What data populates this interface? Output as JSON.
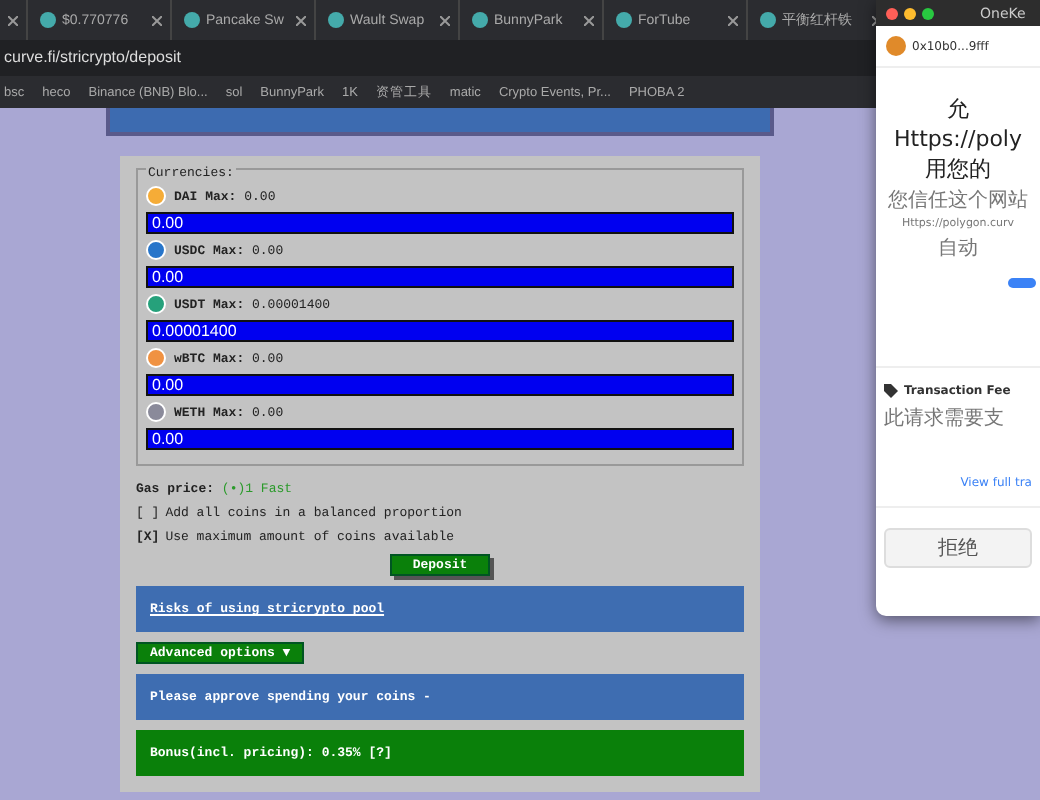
{
  "browser": {
    "tabs": [
      {
        "selected": false
      },
      {
        "label": "$0.770776",
        "selected": false
      },
      {
        "label": "Pancake Sw",
        "selected": false
      },
      {
        "label": "Wault Swap",
        "selected": false
      },
      {
        "label": "BunnyPark",
        "selected": false
      },
      {
        "label": "ForTube",
        "selected": false
      },
      {
        "label": "平衡红杆铁",
        "selected": false
      }
    ],
    "url": "curve.fi/stricrypto/deposit",
    "bookmarks": [
      "bsc",
      "heco",
      "Binance (BNB) Blo...",
      "sol",
      "BunnyPark",
      "1K",
      "资管工具",
      "matic",
      "Crypto Events, Pr...",
      "PHOBA 2"
    ]
  },
  "deposit": {
    "legend": "Currencies:",
    "currencies": [
      {
        "name": "DAI",
        "max_label": "Max:",
        "max": "0.00",
        "value": "0.00",
        "color": "#f5ac37"
      },
      {
        "name": "USDC",
        "max_label": "Max:",
        "max": "0.00",
        "value": "0.00",
        "color": "#2775ca"
      },
      {
        "name": "USDT",
        "max_label": "Max:",
        "max": "0.00001400",
        "value": "0.00001400",
        "color": "#26a17b"
      },
      {
        "name": "wBTC",
        "max_label": "Max:",
        "max": "0.00",
        "value": "0.00",
        "color": "#f09242"
      },
      {
        "name": "WETH",
        "max_label": "Max:",
        "max": "0.00",
        "value": "0.00",
        "color": "#8a8a9a"
      }
    ],
    "gas_label": "Gas price:",
    "gas_value": "(•)1 Fast",
    "options": [
      {
        "mark": "[ ]",
        "label": "Add all coins in a balanced proportion",
        "checked": false
      },
      {
        "mark": "[X]",
        "label": "Use maximum amount of coins available",
        "checked": true
      }
    ],
    "deposit_button": "Deposit",
    "risks_link": "Risks of using stricrypto pool",
    "advanced_button": "Advanced options ▼",
    "approve_note": "Please approve spending your coins -",
    "bonus": "Bonus(incl. pricing): 0.35% [?]"
  },
  "popup": {
    "title": "OneKe",
    "account": "0x10b0...9fff",
    "heading": [
      "允",
      "Https://poly",
      "用您的"
    ],
    "trust": "您信任这个网站",
    "site": "Https://polygon.curv",
    "auto": "自动",
    "fee_title": "Transaction Fee",
    "fee_note": "此请求需要支",
    "view_link": "View full tra",
    "reject_button": "拒绝"
  }
}
